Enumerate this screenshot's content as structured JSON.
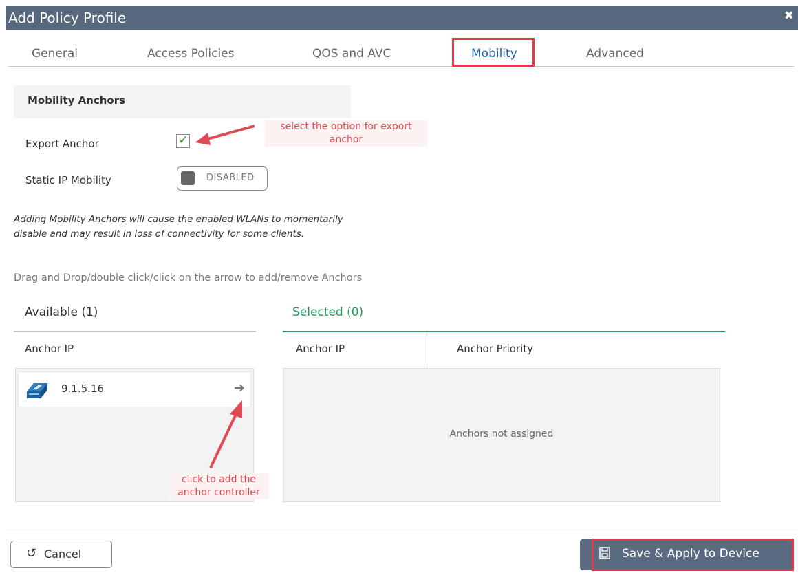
{
  "dialog": {
    "title": "Add Policy Profile",
    "close_glyph": "✖"
  },
  "tabs": [
    {
      "label": "General",
      "active": false
    },
    {
      "label": "Access Policies",
      "active": false
    },
    {
      "label": "QOS and AVC",
      "active": false
    },
    {
      "label": "Mobility",
      "active": true
    },
    {
      "label": "Advanced",
      "active": false
    }
  ],
  "mobility_anchors": {
    "section_title": "Mobility Anchors",
    "export_anchor_label": "Export Anchor",
    "export_anchor_checked": true,
    "static_ip_label": "Static IP Mobility",
    "static_ip_state": "DISABLED",
    "warning_line1": "Adding Mobility Anchors will cause the enabled WLANs to momentarily",
    "warning_line2": "disable and may result in loss of connectivity for some clients.",
    "drag_hint": "Drag and Drop/double click/click on the arrow to add/remove Anchors"
  },
  "available": {
    "title": "Available (1)",
    "column": "Anchor IP",
    "rows": [
      {
        "ip": "9.1.5.16",
        "icon": "controller-icon"
      }
    ]
  },
  "selected": {
    "title": "Selected (0)",
    "columns": [
      "Anchor IP",
      "Anchor Priority"
    ],
    "empty_text": "Anchors not assigned"
  },
  "annotations": {
    "export_line1": "select the option for export",
    "export_line2": "anchor",
    "add_line1": "click to add the",
    "add_line2": "anchor controller"
  },
  "footer": {
    "cancel_label": "Cancel",
    "save_label": "Save & Apply to Device"
  },
  "colors": {
    "titlebar": "#58687c",
    "highlight": "#e23a4a",
    "selected_accent": "#1f9a5a",
    "active_tab": "#1e64a8",
    "save_button": "#5a6a80"
  }
}
